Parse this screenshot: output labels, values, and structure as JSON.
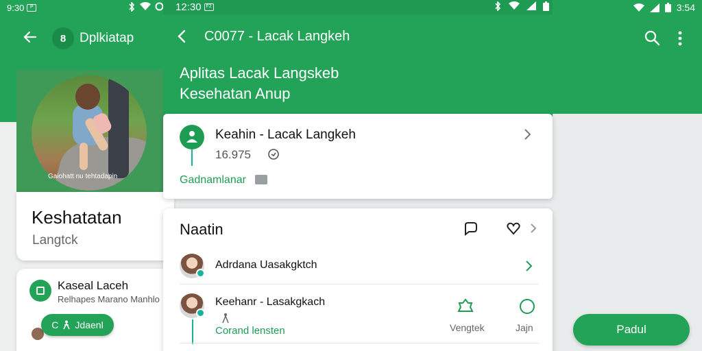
{
  "left_app": {
    "status_time": "9:30",
    "status_badge": "P",
    "title": "Dplkiatap",
    "logo_glyph": "8",
    "photo_caption": "Gaiohatt nu tehtadapin",
    "card_title": "Keshatatan",
    "card_subtitle": "Langtck",
    "lower_title": "Kaseal Laceh",
    "lower_subtitle": "Relhapes Marano Manhlo",
    "pill_label": "Jdaenl",
    "pill_prefix": "C"
  },
  "main_app": {
    "status_time": "12:30",
    "status_badge": "F2",
    "top_title": "C0077 - Lacak Langkeh",
    "header_line1": "Aplitas Lacak Langskeb",
    "header_line2": "Kesehatan Anup",
    "card1": {
      "title": "Keahin - Lacak Langkeh",
      "value": "16.975",
      "link": "Gadnamlanar"
    },
    "card2": {
      "title": "Naatin",
      "rows": [
        {
          "title": "Adrdana Uasakgktch"
        },
        {
          "title": "Keehanr - Lasakgkach",
          "sub": "Corand lensten",
          "steps_label": "Vengtek",
          "circle_label": "Jajn"
        }
      ]
    }
  },
  "right_strip": {
    "status_time": "3:54",
    "fab_label": "Padul"
  },
  "colors": {
    "primary": "#22a358",
    "primary_dark": "#1e9c53",
    "accent_teal": "#1ab29b"
  },
  "icons": [
    "back-arrow-icon",
    "search-icon",
    "more-vert-icon",
    "chevron-right-icon",
    "clock-icon",
    "chat-icon",
    "heart-icon",
    "wifi-icon",
    "signal-icon",
    "battery-icon",
    "walker-icon"
  ]
}
